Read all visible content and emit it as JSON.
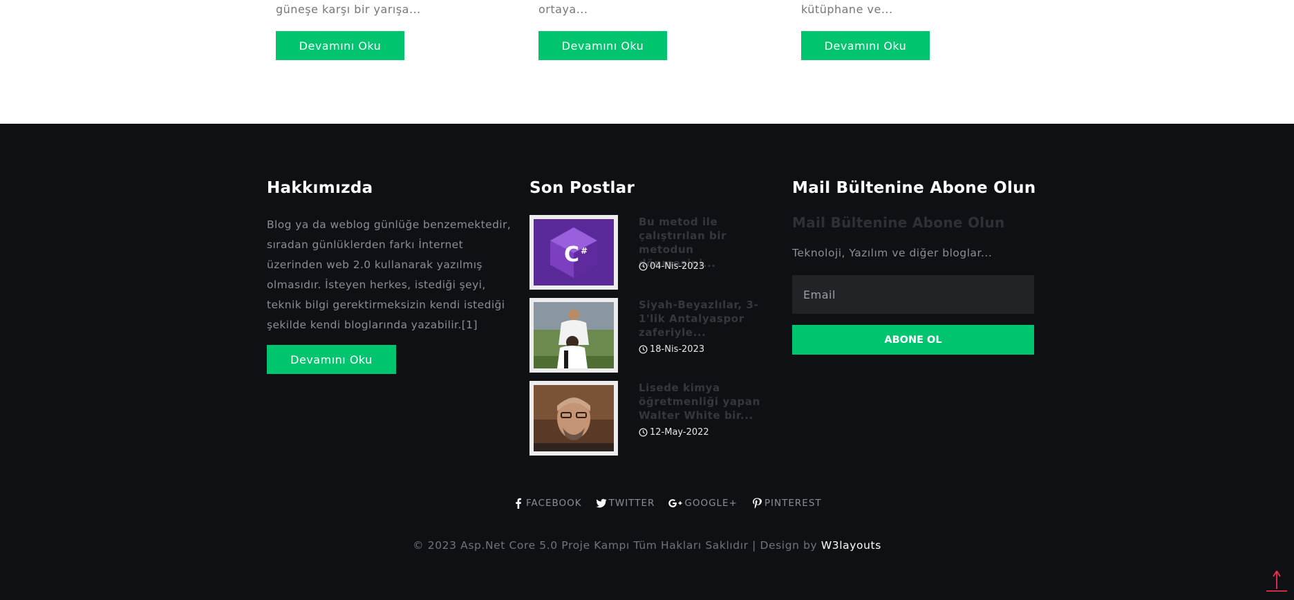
{
  "cards": [
    {
      "excerpt": "güneşe karşı bir yarışa...",
      "button": "Devamını Oku"
    },
    {
      "excerpt": "ortaya...",
      "button": "Devamını Oku"
    },
    {
      "excerpt": "kütüphane ve...",
      "button": "Devamını Oku"
    }
  ],
  "about": {
    "title": "Hakkımızda",
    "text": "Blog ya da weblog günlüğe benzemektedir, sıradan günlüklerden farkı İnternet üzerinden web 2.0 kullanarak yazılmış olmasıdır. İsteyen herkes, istediği şeyi, teknik bilgi gerektirmeksizin kendi istediği şekilde kendi bloglarında yazabilir.[1]",
    "button": "Devamını Oku"
  },
  "recent": {
    "title": "Son Postlar",
    "posts": [
      {
        "title": "Bu metod ile çalıştırılan bir metodun dönmesini...",
        "date": "04-Nis-2023",
        "thumb_icon": "csharp-logo-icon"
      },
      {
        "title": "Siyah-Beyazlılar, 3-1'lik Antalyaspor zaferiyle...",
        "date": "18-Nis-2023",
        "thumb_icon": "football-players-photo"
      },
      {
        "title": "Lisede kimya öğretmenliği yapan Walter White bir...",
        "date": "12-May-2022",
        "thumb_icon": "portrait-photo"
      }
    ]
  },
  "newsletter": {
    "title": "Mail Bültenine Abone Olun",
    "subtitle": "Mail Bültenine Abone Olun",
    "text": "Teknoloji, Yazılım ve diğer bloglar...",
    "email_placeholder": "Email",
    "button": "ABONE OL"
  },
  "social": [
    {
      "label": "FACEBOOK",
      "icon": "facebook-icon"
    },
    {
      "label": "TWITTER",
      "icon": "twitter-icon"
    },
    {
      "label": "GOOGLE+",
      "icon": "google-plus-icon"
    },
    {
      "label": "PINTEREST",
      "icon": "pinterest-icon"
    }
  ],
  "footer": {
    "copyright": "© 2023 Asp.Net Core 5.0 Proje Kampı Tüm Hakları Saklıdır | Design by ",
    "design_link": "W3layouts"
  },
  "colors": {
    "accent": "#00c56e",
    "footer_bg": "#0e1014",
    "scroll_top": "#e8334a"
  }
}
